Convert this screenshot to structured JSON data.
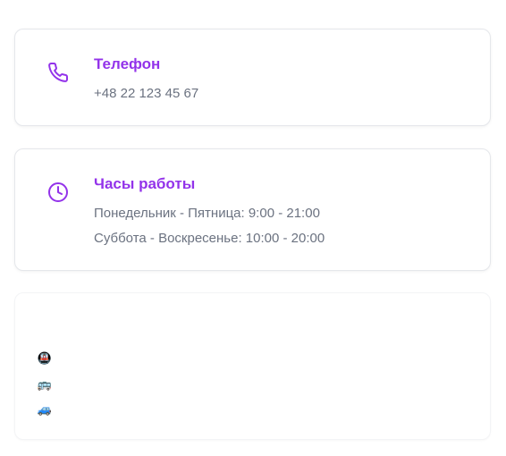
{
  "accent_color": "#9333ea",
  "phone": {
    "icon": "phone-icon",
    "title": "Телефон",
    "number": "+48 22 123 45 67"
  },
  "hours": {
    "icon": "clock-icon",
    "title": "Часы работы",
    "weekdays": "Понедельник - Пятница: 9:00 - 21:00",
    "weekend": "Суббота - Воскресенье: 10:00 - 20:00"
  },
  "transport": {
    "items": [
      {
        "icon": "metro-icon",
        "glyph": "🚇"
      },
      {
        "icon": "bus-icon",
        "glyph": "🚌"
      },
      {
        "icon": "car-icon",
        "glyph": "🚙"
      }
    ]
  }
}
